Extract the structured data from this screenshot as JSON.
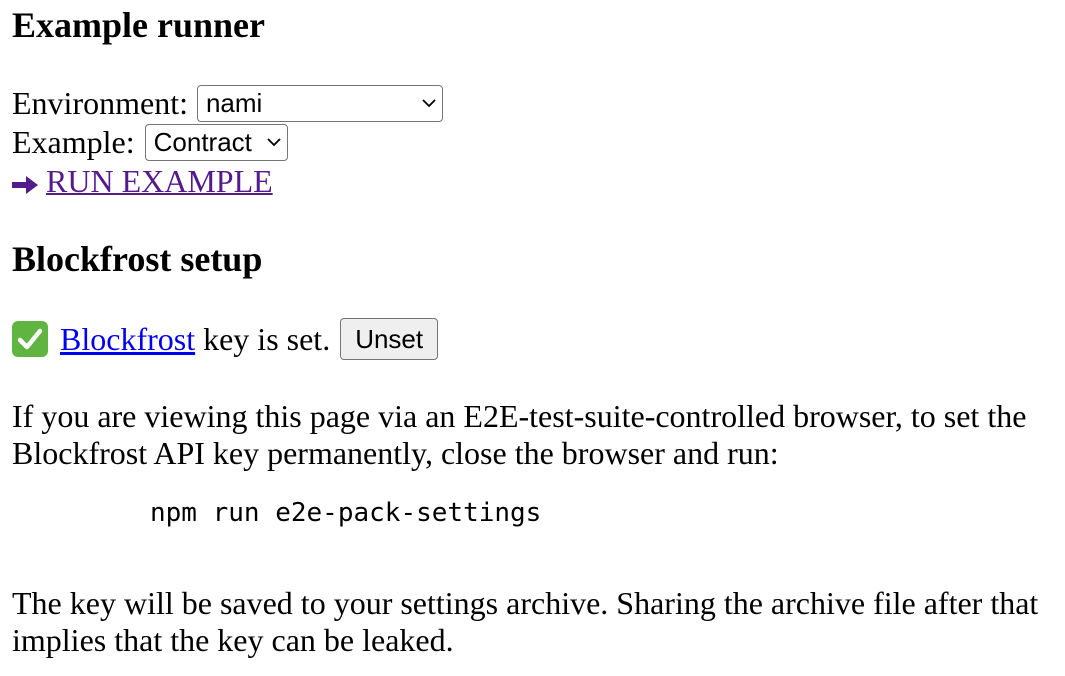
{
  "runner": {
    "title": "Example runner",
    "environment_label": "Environment:",
    "environment_value": "nami",
    "example_label": "Example:",
    "example_value": "Contract",
    "run_link": "RUN EXAMPLE",
    "run_icon": "right-arrow-icon"
  },
  "blockfrost": {
    "title": "Blockfrost setup",
    "status_icon": "check-mark-icon",
    "link_text": "Blockfrost",
    "status_text": " key is set.",
    "unset_button": "Unset",
    "instructions": "If you are viewing this page via an E2E-test-suite-controlled browser, to set the Blockfrost API key permanently, close the browser and run:",
    "command": "npm run e2e-pack-settings",
    "warning": "The key will be saved to your settings archive. Sharing the archive file after that implies that the key can be leaked."
  },
  "colors": {
    "link": "#0000ee",
    "visited_link": "#551a8b",
    "check_background": "#5fb53f"
  }
}
